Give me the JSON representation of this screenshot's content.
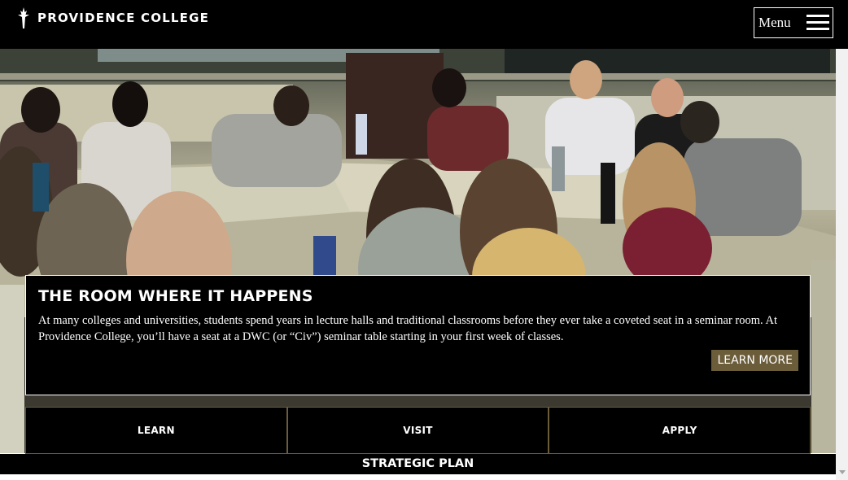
{
  "header": {
    "logo_text": "PROVIDENCE COLLEGE",
    "menu_label": "Menu"
  },
  "feature": {
    "title": "THE ROOM WHERE IT HAPPENS",
    "body": "At many colleges and universities, students spend years in lecture halls and traditional classrooms before they ever take a coveted seat in a seminar room. At Providence College, you’ll have a seat at a DWC (or “Civ”) seminar table starting in your first week of classes.",
    "button_label": "LEARN MORE",
    "button_color": "#6b5c3a"
  },
  "cta": [
    {
      "label": "LEARN"
    },
    {
      "label": "VISIT"
    },
    {
      "label": "APPLY"
    }
  ],
  "footer_bar": {
    "label": "STRATEGIC PLAN"
  },
  "colors": {
    "background": "#000000",
    "text": "#ffffff",
    "accent": "#6b5c3a"
  }
}
